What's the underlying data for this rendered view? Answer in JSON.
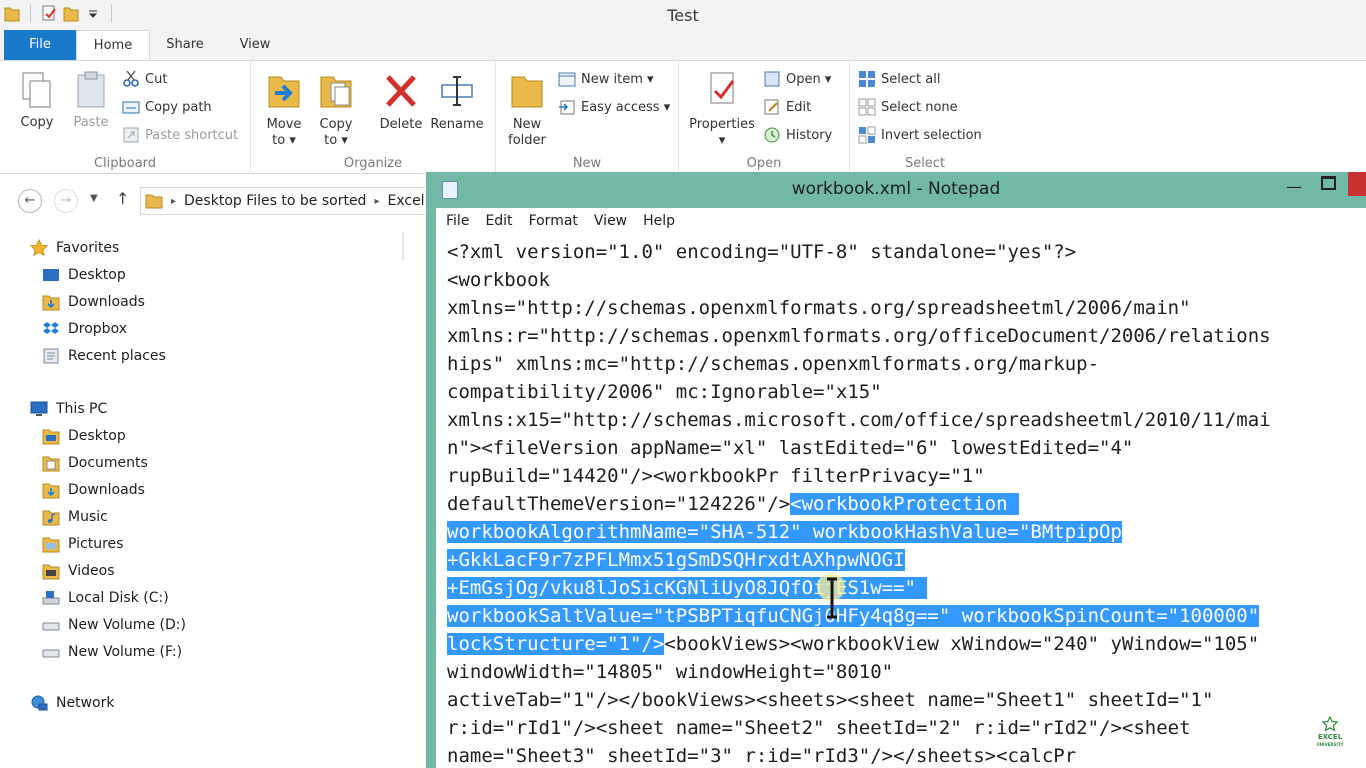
{
  "explorer": {
    "title": "Test",
    "tabs": {
      "file": "File",
      "home": "Home",
      "share": "Share",
      "view": "View"
    },
    "ribbon": {
      "clipboard": {
        "label": "Clipboard",
        "copy": "Copy",
        "paste": "Paste",
        "cut": "Cut",
        "copy_path": "Copy path",
        "paste_shortcut": "Paste shortcut"
      },
      "organize": {
        "label": "Organize",
        "move_to": "Move",
        "move_to_2": "to ▾",
        "copy_to": "Copy",
        "copy_to_2": "to ▾",
        "delete": "Delete",
        "rename": "Rename"
      },
      "new": {
        "label": "New",
        "new_folder": "New",
        "new_folder_2": "folder",
        "new_item": "New item ▾",
        "easy_access": "Easy access ▾"
      },
      "open": {
        "label": "Open",
        "properties": "Properties",
        "open": "Open ▾",
        "edit": "Edit",
        "history": "History"
      },
      "select": {
        "label": "Select",
        "select_all": "Select all",
        "select_none": "Select none",
        "invert_selection": "Invert selection"
      }
    },
    "address": {
      "part1": "Desktop Files to be sorted",
      "part2": "Excel"
    },
    "nav": {
      "favorites": "Favorites",
      "fav_items": [
        "Desktop",
        "Downloads",
        "Dropbox",
        "Recent places"
      ],
      "this_pc": "This PC",
      "pc_items": [
        "Desktop",
        "Documents",
        "Downloads",
        "Music",
        "Pictures",
        "Videos",
        "Local Disk (C:)",
        "New Volume (D:)",
        "New Volume (F:)"
      ],
      "network": "Network"
    }
  },
  "notepad": {
    "title": "workbook.xml - Notepad",
    "menu": [
      "File",
      "Edit",
      "Format",
      "View",
      "Help"
    ],
    "lines": [
      {
        "pre": "<?xml version=\"1.0\" encoding=\"UTF-8\" standalone=\"yes\"?>",
        "sel": "",
        "post": ""
      },
      {
        "pre": "<workbook",
        "sel": "",
        "post": ""
      },
      {
        "pre": "xmlns=\"http://schemas.openxmlformats.org/spreadsheetml/2006/main\"",
        "sel": "",
        "post": ""
      },
      {
        "pre": "xmlns:r=\"http://schemas.openxmlformats.org/officeDocument/2006/relations",
        "sel": "",
        "post": ""
      },
      {
        "pre": "hips\" xmlns:mc=\"http://schemas.openxmlformats.org/markup-",
        "sel": "",
        "post": ""
      },
      {
        "pre": "compatibility/2006\" mc:Ignorable=\"x15\"",
        "sel": "",
        "post": ""
      },
      {
        "pre": "xmlns:x15=\"http://schemas.microsoft.com/office/spreadsheetml/2010/11/mai",
        "sel": "",
        "post": ""
      },
      {
        "pre": "n\"><fileVersion appName=\"xl\" lastEdited=\"6\" lowestEdited=\"4\"",
        "sel": "",
        "post": ""
      },
      {
        "pre": "rupBuild=\"14420\"/><workbookPr filterPrivacy=\"1\"",
        "sel": "",
        "post": ""
      },
      {
        "pre": "defaultThemeVersion=\"124226\"/>",
        "sel": "<workbookProtection ",
        "post": ""
      },
      {
        "pre": "",
        "sel": "workbookAlgorithmName=\"SHA-512\" workbookHashValue=\"BMtpipOp",
        "post": ""
      },
      {
        "pre": "",
        "sel": "+GkkLacF9r7zPFLMmx51gSmDSQHrxdtAXhpwNOGI",
        "post": ""
      },
      {
        "pre": "",
        "sel": "+EmGsjOg/vku8lJoSicKGNliUyO8JQfOijES1w==\" ",
        "post": ""
      },
      {
        "pre": "",
        "sel": "workbookSaltValue=\"tPSBPTiqfuCNGj0HFy4q8g==\" workbookSpinCount=\"100000\"",
        "post": ""
      },
      {
        "pre": "",
        "sel": "lockStructure=\"1\"/>",
        "post": "<bookViews><workbookView xWindow=\"240\" yWindow=\"105\""
      },
      {
        "pre": "windowWidth=\"14805\" windowHeight=\"8010\"",
        "sel": "",
        "post": ""
      },
      {
        "pre": "activeTab=\"1\"/></bookViews><sheets><sheet name=\"Sheet1\" sheetId=\"1\"",
        "sel": "",
        "post": ""
      },
      {
        "pre": "r:id=\"rId1\"/><sheet name=\"Sheet2\" sheetId=\"2\" r:id=\"rId2\"/><sheet",
        "sel": "",
        "post": ""
      },
      {
        "pre": "name=\"Sheet3\" sheetId=\"3\" r:id=\"rId3\"/></sheets><calcPr",
        "sel": "",
        "post": ""
      }
    ]
  },
  "watermark": {
    "line1": "EXCEL",
    "line2": "UNIVERSITY"
  },
  "colors": {
    "ribbon_file": "#1979ca",
    "notepad_frame": "#72b8a6",
    "selection": "#3399ff",
    "close": "#c93131"
  }
}
